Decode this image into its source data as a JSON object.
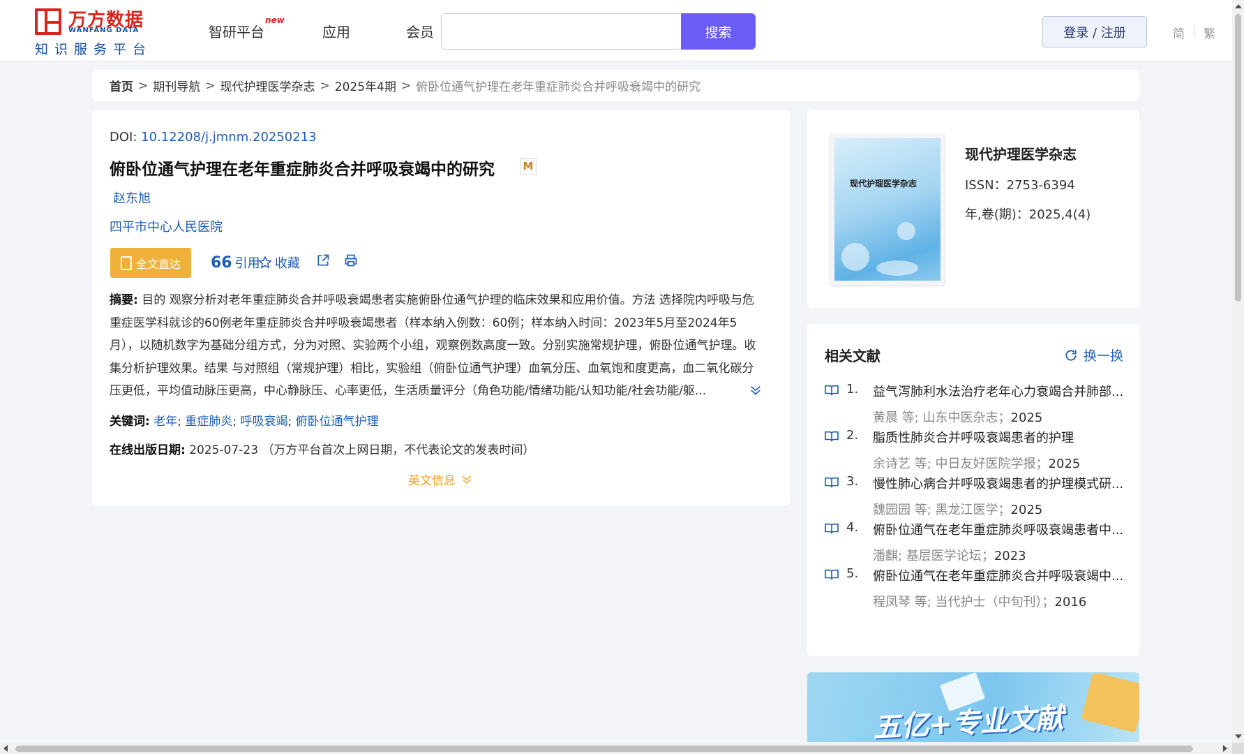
{
  "header": {
    "logo": {
      "cn": "万方数据",
      "en": "WANFANG DATA",
      "sub": "知识服务平台"
    },
    "nav": [
      {
        "label": "智研平台",
        "badge": "new"
      },
      {
        "label": "应用"
      },
      {
        "label": "会员"
      }
    ],
    "search": {
      "value": "",
      "placeholder": "",
      "button": "搜索"
    },
    "login": "登录 / 注册",
    "lang": [
      "简",
      "繁"
    ]
  },
  "breadcrumb": [
    "首页",
    "期刊导航",
    "现代护理医学杂志",
    "2025年4期",
    "俯卧位通气护理在老年重症肺炎合并呼吸衰竭中的研究"
  ],
  "paper": {
    "doi_label": "DOI: ",
    "doi": "10.12208/j.jmnm.20250213",
    "title": "俯卧位通气护理在老年重症肺炎合并呼吸衰竭中的研究",
    "author": "赵东旭",
    "org": "四平市中心人民医院",
    "actions": {
      "fulltext": "全文直达",
      "cite": "引用",
      "collect": "收藏"
    },
    "abstract_label": "摘要:",
    "abstract": "目的 观察分析对老年重症肺炎合并呼吸衰竭患者实施俯卧位通气护理的临床效果和应用价值。方法 选择院内呼吸与危重症医学科就诊的60例老年重症肺炎合并呼吸衰竭患者（样本纳入例数：60例；样本纳入时间：2023年5月至2024年5月），以随机数字为基础分组方式，分为对照、实验两个小组，观察例数高度一致。分别实施常规护理，俯卧位通气护理。收集分析护理效果。结果 与对照组（常规护理）相比，实验组（俯卧位通气护理）血氧分压、血氧饱和度更高，血二氧化碳分压更低，平均值动脉压更高，中心静脉压、心率更低，生活质量评分（角色功能/情绪功能/认知功能/社会功能/躯...",
    "keywords_label": "关键词:",
    "keywords": [
      "老年",
      "重症肺炎",
      "呼吸衰竭",
      "俯卧位通气护理"
    ],
    "date_label": "在线出版日期:",
    "date": "2025-07-23",
    "date_note": "（万方平台首次上网日期，不代表论文的发表时间）",
    "en_info": "英文信息"
  },
  "journal": {
    "cover_title": "现代护理医学杂志",
    "name": "现代护理医学杂志",
    "issn": "ISSN：2753-6394",
    "volume": "年,卷(期)：2025,4(4)"
  },
  "related": {
    "title": "相关文献",
    "refresh": "换一换",
    "items": [
      {
        "num": "1.",
        "title": "益气泻肺利水法治疗老年心力衰竭合并肺部...",
        "authors": "黄晨",
        "etal": "等;",
        "source": "山东中医杂志；",
        "year": "2025"
      },
      {
        "num": "2.",
        "title": "脂质性肺炎合并呼吸衰竭患者的护理",
        "authors": "余诗艺",
        "etal": "等;",
        "source": "中日友好医院学报；",
        "year": "2025"
      },
      {
        "num": "3.",
        "title": "慢性肺心病合并呼吸衰竭患者的护理模式研...",
        "authors": "魏园园",
        "etal": "等;",
        "source": "黑龙江医学；",
        "year": "2025"
      },
      {
        "num": "4.",
        "title": "俯卧位通气在老年重症肺炎呼吸衰竭患者中...",
        "authors": "潘麒;",
        "etal": "",
        "source": "基层医学论坛；",
        "year": "2023"
      },
      {
        "num": "5.",
        "title": "俯卧位通气在老年重症肺炎合并呼吸衰竭中...",
        "authors": "程凤琴",
        "etal": "等;",
        "source": "当代护士（中旬刊）；",
        "year": "2016"
      }
    ]
  },
  "banner": {
    "text": "五亿+专业文献"
  },
  "colors": {
    "accent": "#6b5cf6",
    "link": "#1e5db6",
    "orange": "#f0b13a",
    "brand_red": "#d7261e"
  }
}
